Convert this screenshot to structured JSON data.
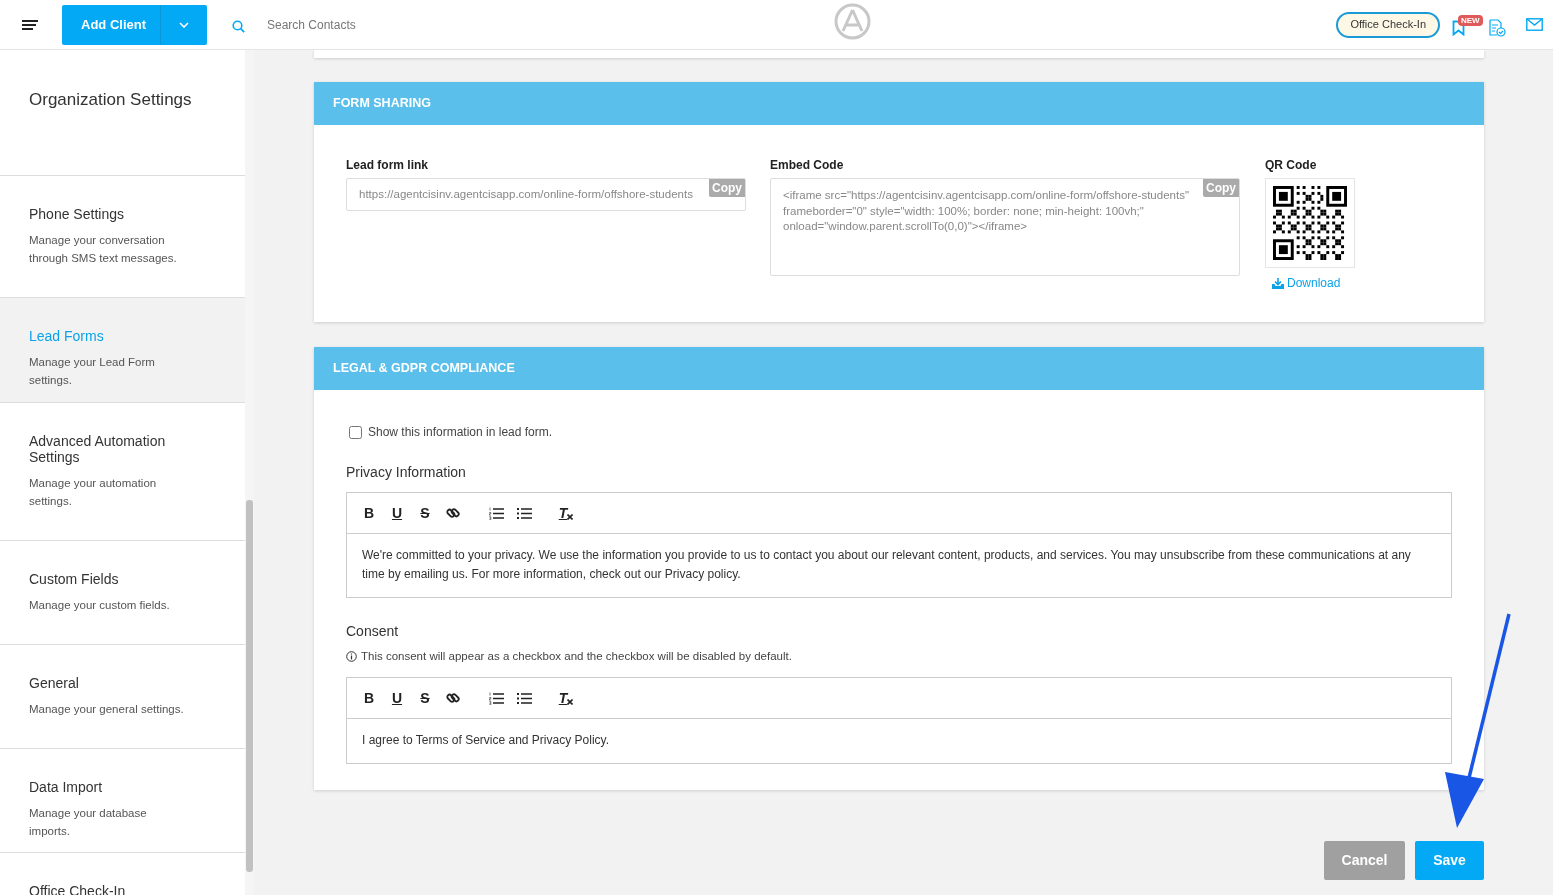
{
  "header": {
    "add_button": "Add Client",
    "search": {
      "placeholder": "Search Contacts"
    },
    "checkin_button": "Office Check-In",
    "badge": "NEW"
  },
  "sidebar": {
    "title": "Organization Settings",
    "items": [
      {
        "title": "Phone Settings",
        "description": "Manage your conversation through SMS text messages.",
        "selected": false
      },
      {
        "title": "Lead Forms",
        "description": "Manage your Lead Form settings.",
        "selected": true
      },
      {
        "title": "Advanced Automation Settings",
        "description": "Manage your automation settings.",
        "selected": false
      },
      {
        "title": "Custom Fields",
        "description": "Manage your custom fields.",
        "selected": false
      },
      {
        "title": "General",
        "description": "Manage your general settings.",
        "selected": false
      },
      {
        "title": "Data Import",
        "description": "Manage your database imports.",
        "selected": false
      },
      {
        "title": "Office Check-In",
        "selected": false
      }
    ]
  },
  "form_sharing": {
    "title": "FORM SHARING",
    "link_label": "Lead form link",
    "link_value": "https://agentcisinv.agentcisapp.com/online-form/offshore-students",
    "embed_label": "Embed Code",
    "embed_value": "<iframe src=\"https://agentcisinv.agentcisapp.com/online-form/offshore-students\" frameborder=\"0\" style=\"width: 100%; border: none; min-height: 100vh;\" onload=\"window.parent.scrollTo(0,0)\"></iframe>",
    "link_copy_label": "Copy",
    "embed_copy_label": "Copy",
    "qr_label": "QR Code",
    "download_label": "Download"
  },
  "legal": {
    "title": "LEGAL & GDPR COMPLIANCE",
    "show_checkbox": {
      "label": "Show this information in lead form.",
      "checked": false
    },
    "privacy_label": "Privacy Information",
    "privacy_text": "We're committed to your privacy. We use the information you provide to us to contact you about our relevant content, products, and services. You may unsubscribe from these communications at any time by emailing us. For more information, check out our Privacy policy.",
    "consent_label": "Consent",
    "consent_note": "This consent will appear as a checkbox and the checkbox will be disabled by default.",
    "consent_text": "I agree to Terms of Service and Privacy Policy.",
    "privacy_toolbar": [
      {
        "kind": "bold",
        "label": "B"
      },
      {
        "kind": "underline",
        "label": "U"
      },
      {
        "kind": "strike",
        "label": "S"
      },
      {
        "kind": "link"
      },
      {
        "kind": "ordered-list"
      },
      {
        "kind": "bullet-list"
      },
      {
        "kind": "clear-format",
        "label": "T"
      }
    ],
    "consent_toolbar": [
      {
        "kind": "bold",
        "label": "B"
      },
      {
        "kind": "underline",
        "label": "U"
      },
      {
        "kind": "strike",
        "label": "S"
      },
      {
        "kind": "link"
      },
      {
        "kind": "ordered-list"
      },
      {
        "kind": "bullet-list"
      },
      {
        "kind": "clear-format",
        "label": "T"
      }
    ]
  },
  "buttons": [
    {
      "label": "Cancel",
      "kind": "secondary"
    },
    {
      "label": "Save",
      "kind": "primary"
    }
  ]
}
